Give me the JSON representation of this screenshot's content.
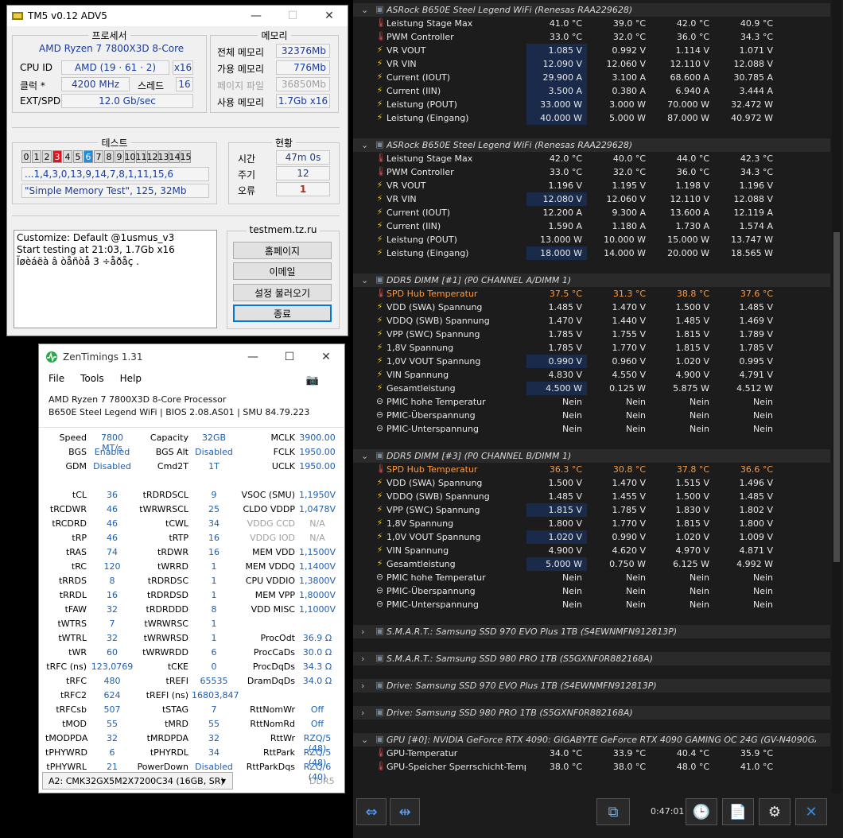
{
  "tm5": {
    "title": "TM5 v0.12 ADV5",
    "processor_group": "프로세서",
    "memory_group": "메모리",
    "cpu_name": "AMD Ryzen 7 7800X3D 8-Core",
    "cpu_id_label": "CPU ID",
    "cpu_id_value": "AMD  (19 · 61 · 2)",
    "cpu_threads_mult": "x16",
    "clock_label": "클럭 *",
    "clock_value": "4200 MHz",
    "thread_label": "스레드",
    "thread_value": "16",
    "extspd_label": "EXT/SPD",
    "extspd_value": "12.0 Gb/sec",
    "mem_total_label": "전체 메모리",
    "mem_total_value": "32376Mb",
    "mem_avail_label": "가용 메모리",
    "mem_avail_value": "776Mb",
    "mem_page_label": "페이지 파일",
    "mem_page_value": "36850Mb",
    "mem_used_label": "사용 메모리",
    "mem_used_value": "1.7Gb x16",
    "test_group": "테스트",
    "status_group": "현황",
    "cells": [
      "0",
      "1",
      "2",
      "3",
      "4",
      "5",
      "6",
      "7",
      "8",
      "9",
      "10",
      "11",
      "12",
      "13",
      "14",
      "15"
    ],
    "sequence": "...1,4,3,0,13,9,14,7,8,1,11,15,6",
    "current_test": "\"Simple Memory Test\", 125, 32Mb",
    "time_label": "시간",
    "time_value": "47m 0s",
    "cycle_label": "주기",
    "cycle_value": "12",
    "error_label": "오류",
    "error_value": "1",
    "log_lines": "Customize: Default @1usmus_v3\nStart testing at 21:03, 1.7Gb x16\nÏøèáëà â òåñòå 3 ÷åðåç .",
    "site": "testmem.tz.ru",
    "btn_home": "홈페이지",
    "btn_email": "이메일",
    "btn_load": "설정 불러오기",
    "btn_exit": "종료",
    "colors": {
      "error": "#e0141e",
      "active": "#1a8ee0"
    }
  },
  "zen": {
    "title": "ZenTimings 1.31",
    "menu": [
      "File",
      "Tools",
      "Help"
    ],
    "cpu": "AMD Ryzen 7 7800X3D 8-Core Processor",
    "board": "B650E Steel Legend WiFi | BIOS 2.08.AS01 | SMU 84.79.223",
    "col1": [
      [
        "Speed",
        "7800 MT/s"
      ],
      [
        "BGS",
        "Enabled"
      ],
      [
        "GDM",
        "Disabled"
      ],
      null,
      [
        "tCL",
        "36"
      ],
      [
        "tRCDWR",
        "46"
      ],
      [
        "tRCDRD",
        "46"
      ],
      [
        "tRP",
        "46"
      ],
      [
        "tRAS",
        "74"
      ],
      [
        "tRC",
        "120"
      ],
      [
        "tRRDS",
        "8"
      ],
      [
        "tRRDL",
        "16"
      ],
      [
        "tFAW",
        "32"
      ],
      [
        "tWTRS",
        "7"
      ],
      [
        "tWTRL",
        "32"
      ],
      [
        "tWR",
        "60"
      ],
      [
        "tRFC (ns)",
        "123,0769"
      ],
      [
        "tRFC",
        "480"
      ],
      [
        "tRFC2",
        "624"
      ],
      [
        "tRFCsb",
        "507"
      ],
      [
        "tMOD",
        "55"
      ],
      [
        "tMODPDA",
        "32"
      ],
      [
        "tPHYWRD",
        "6"
      ],
      [
        "tPHYWRL",
        "21"
      ]
    ],
    "col2": [
      [
        "Capacity",
        "32GB"
      ],
      [
        "BGS Alt",
        "Disabled"
      ],
      [
        "Cmd2T",
        "1T"
      ],
      null,
      [
        "tRDRDSCL",
        "9"
      ],
      [
        "tWRWRSCL",
        "25"
      ],
      [
        "tCWL",
        "34"
      ],
      [
        "tRTP",
        "16"
      ],
      [
        "tRDWR",
        "16"
      ],
      [
        "tWRRD",
        "1"
      ],
      [
        "tRDRDSC",
        "1"
      ],
      [
        "tRDRDSD",
        "1"
      ],
      [
        "tRDRDDD",
        "8"
      ],
      [
        "tWRWRSC",
        "1"
      ],
      [
        "tWRWRSD",
        "1"
      ],
      [
        "tWRWRDD",
        "6"
      ],
      [
        "tCKE",
        "0"
      ],
      [
        "tREFI",
        "65535"
      ],
      [
        "tREFI (ns)",
        "16803,847"
      ],
      [
        "tSTAG",
        "7"
      ],
      [
        "tMRD",
        "55"
      ],
      [
        "tMRDPDA",
        "32"
      ],
      [
        "tPHYRDL",
        "34"
      ],
      [
        "PowerDown",
        "Disabled"
      ]
    ],
    "col3": [
      [
        "MCLK",
        "3900.00"
      ],
      [
        "FCLK",
        "1950.00"
      ],
      [
        "UCLK",
        "1950.00"
      ],
      null,
      [
        "VSOC (SMU)",
        "1,1950V"
      ],
      [
        "CLDO VDDP",
        "1,0478V"
      ],
      [
        "VDDG CCD",
        "N/A"
      ],
      [
        "VDDG IOD",
        "N/A"
      ],
      [
        "MEM VDD",
        "1,1500V"
      ],
      [
        "MEM VDDQ",
        "1,1400V"
      ],
      [
        "CPU VDDIO",
        "1,3800V"
      ],
      [
        "MEM VPP",
        "1,8000V"
      ],
      [
        "VDD MISC",
        "1,1000V"
      ],
      null,
      [
        "ProcOdt",
        "36.9 Ω"
      ],
      [
        "ProcCaDs",
        "30.0 Ω"
      ],
      [
        "ProcDqDs",
        "34.3 Ω"
      ],
      [
        "DramDqDs",
        "34.0 Ω"
      ],
      null,
      [
        "RttNomWr",
        "Off"
      ],
      [
        "RttNomRd",
        "Off"
      ],
      [
        "RttWr",
        "RZQ/5 (48)"
      ],
      [
        "RttPark",
        "RZQ/5 (48)"
      ],
      [
        "RttParkDqs",
        "RZQ/6 (40)"
      ]
    ],
    "module": "A2: CMK32GX5M2X7200C34 (16GB, SR)",
    "ddr": "DDR5"
  },
  "hw": {
    "rows": [
      {
        "t": "h",
        "n": "ASRock B650E Steel Legend WiFi (Renesas RAA229628)"
      },
      {
        "i": "temp",
        "n": "Leistung Stage Max",
        "v": [
          "41.0 °C",
          "39.0 °C",
          "42.0 °C",
          "40.9 °C"
        ]
      },
      {
        "i": "temp",
        "n": "PWM Controller",
        "v": [
          "33.0 °C",
          "32.0 °C",
          "36.0 °C",
          "34.3 °C"
        ]
      },
      {
        "i": "bolt",
        "n": "VR VOUT",
        "v": [
          "1.085 V",
          "0.992 V",
          "1.114 V",
          "1.071 V"
        ],
        "hl": 1
      },
      {
        "i": "bolt",
        "n": "VR VIN",
        "v": [
          "12.090 V",
          "12.060 V",
          "12.110 V",
          "12.088 V"
        ],
        "hl": 1
      },
      {
        "i": "bolt",
        "n": "Current (IOUT)",
        "v": [
          "29.900 A",
          "3.100 A",
          "68.600 A",
          "30.785 A"
        ],
        "hl": 1
      },
      {
        "i": "bolt",
        "n": "Current (IIN)",
        "v": [
          "3.500 A",
          "0.380 A",
          "6.940 A",
          "3.444 A"
        ],
        "hl": 1
      },
      {
        "i": "bolt",
        "n": "Leistung (POUT)",
        "v": [
          "33.000 W",
          "3.000 W",
          "70.000 W",
          "32.472 W"
        ],
        "hl": 1
      },
      {
        "i": "bolt",
        "n": "Leistung (Eingang)",
        "v": [
          "40.000 W",
          "5.000 W",
          "87.000 W",
          "40.972 W"
        ],
        "hl": 1
      },
      {
        "t": "g"
      },
      {
        "t": "h",
        "n": "ASRock B650E Steel Legend WiFi (Renesas RAA229628)"
      },
      {
        "i": "temp",
        "n": "Leistung Stage Max",
        "v": [
          "42.0 °C",
          "40.0 °C",
          "44.0 °C",
          "42.3 °C"
        ]
      },
      {
        "i": "temp",
        "n": "PWM Controller",
        "v": [
          "33.0 °C",
          "32.0 °C",
          "36.0 °C",
          "34.3 °C"
        ]
      },
      {
        "i": "bolt",
        "n": "VR VOUT",
        "v": [
          "1.196 V",
          "1.195 V",
          "1.198 V",
          "1.196 V"
        ]
      },
      {
        "i": "bolt",
        "n": "VR VIN",
        "v": [
          "12.080 V",
          "12.060 V",
          "12.110 V",
          "12.088 V"
        ],
        "hl": 1
      },
      {
        "i": "bolt",
        "n": "Current (IOUT)",
        "v": [
          "12.200 A",
          "9.300 A",
          "13.600 A",
          "12.119 A"
        ]
      },
      {
        "i": "bolt",
        "n": "Current (IIN)",
        "v": [
          "1.590 A",
          "1.180 A",
          "1.730 A",
          "1.574 A"
        ]
      },
      {
        "i": "bolt",
        "n": "Leistung (POUT)",
        "v": [
          "13.000 W",
          "10.000 W",
          "15.000 W",
          "13.747 W"
        ]
      },
      {
        "i": "bolt",
        "n": "Leistung (Eingang)",
        "v": [
          "18.000 W",
          "14.000 W",
          "20.000 W",
          "18.565 W"
        ],
        "hl": 1
      },
      {
        "t": "g"
      },
      {
        "t": "h",
        "n": "DDR5 DIMM [#1] (P0 CHANNEL A/DIMM 1)"
      },
      {
        "i": "temp",
        "n": "SPD Hub Temperatur",
        "v": [
          "37.5 °C",
          "31.3 °C",
          "38.8 °C",
          "37.6 °C"
        ],
        "or": 1
      },
      {
        "i": "bolt",
        "n": "VDD (SWA) Spannung",
        "v": [
          "1.485 V",
          "1.470 V",
          "1.500 V",
          "1.485 V"
        ]
      },
      {
        "i": "bolt",
        "n": "VDDQ (SWB) Spannung",
        "v": [
          "1.470 V",
          "1.440 V",
          "1.485 V",
          "1.469 V"
        ]
      },
      {
        "i": "bolt",
        "n": "VPP (SWC) Spannung",
        "v": [
          "1.785 V",
          "1.755 V",
          "1.815 V",
          "1.789 V"
        ]
      },
      {
        "i": "bolt",
        "n": "1,8V Spannung",
        "v": [
          "1.785 V",
          "1.770 V",
          "1.815 V",
          "1.785 V"
        ]
      },
      {
        "i": "bolt",
        "n": "1,0V VOUT Spannung",
        "v": [
          "0.990 V",
          "0.960 V",
          "1.020 V",
          "0.995 V"
        ],
        "hl": 1
      },
      {
        "i": "bolt",
        "n": "VIN Spannung",
        "v": [
          "4.830 V",
          "4.550 V",
          "4.900 V",
          "4.791 V"
        ]
      },
      {
        "i": "bolt",
        "n": "Gesamtleistung",
        "v": [
          "4.500 W",
          "0.125 W",
          "5.875 W",
          "4.512 W"
        ],
        "hl": 1
      },
      {
        "i": "circ",
        "n": "PMIC hohe Temperatur",
        "v": [
          "Nein",
          "Nein",
          "Nein",
          "Nein"
        ]
      },
      {
        "i": "circ",
        "n": "PMIC-Überspannung",
        "v": [
          "Nein",
          "Nein",
          "Nein",
          "Nein"
        ]
      },
      {
        "i": "circ",
        "n": "PMIC-Unterspannung",
        "v": [
          "Nein",
          "Nein",
          "Nein",
          "Nein"
        ]
      },
      {
        "t": "g"
      },
      {
        "t": "h",
        "n": "DDR5 DIMM [#3] (P0 CHANNEL B/DIMM 1)"
      },
      {
        "i": "temp",
        "n": "SPD Hub Temperatur",
        "v": [
          "36.3 °C",
          "30.8 °C",
          "37.8 °C",
          "36.6 °C"
        ],
        "or": 1
      },
      {
        "i": "bolt",
        "n": "VDD (SWA) Spannung",
        "v": [
          "1.500 V",
          "1.470 V",
          "1.515 V",
          "1.496 V"
        ]
      },
      {
        "i": "bolt",
        "n": "VDDQ (SWB) Spannung",
        "v": [
          "1.485 V",
          "1.455 V",
          "1.500 V",
          "1.485 V"
        ]
      },
      {
        "i": "bolt",
        "n": "VPP (SWC) Spannung",
        "v": [
          "1.815 V",
          "1.785 V",
          "1.830 V",
          "1.802 V"
        ],
        "hl": 1
      },
      {
        "i": "bolt",
        "n": "1,8V Spannung",
        "v": [
          "1.800 V",
          "1.770 V",
          "1.815 V",
          "1.800 V"
        ]
      },
      {
        "i": "bolt",
        "n": "1,0V VOUT Spannung",
        "v": [
          "1.020 V",
          "0.990 V",
          "1.020 V",
          "1.009 V"
        ],
        "hl": 1
      },
      {
        "i": "bolt",
        "n": "VIN Spannung",
        "v": [
          "4.900 V",
          "4.620 V",
          "4.970 V",
          "4.871 V"
        ]
      },
      {
        "i": "bolt",
        "n": "Gesamtleistung",
        "v": [
          "5.000 W",
          "0.750 W",
          "6.125 W",
          "4.992 W"
        ],
        "hl": 1
      },
      {
        "i": "circ",
        "n": "PMIC hohe Temperatur",
        "v": [
          "Nein",
          "Nein",
          "Nein",
          "Nein"
        ]
      },
      {
        "i": "circ",
        "n": "PMIC-Überspannung",
        "v": [
          "Nein",
          "Nein",
          "Nein",
          "Nein"
        ]
      },
      {
        "i": "circ",
        "n": "PMIC-Unterspannung",
        "v": [
          "Nein",
          "Nein",
          "Nein",
          "Nein"
        ]
      },
      {
        "t": "g"
      },
      {
        "t": "c",
        "n": "S.M.A.R.T.: Samsung SSD 970 EVO Plus 1TB (S4EWNMFN912813P)"
      },
      {
        "t": "g"
      },
      {
        "t": "c",
        "n": "S.M.A.R.T.: Samsung SSD 980 PRO 1TB (S5GXNF0R882168A)"
      },
      {
        "t": "g"
      },
      {
        "t": "c",
        "n": "Drive: Samsung SSD 970 EVO Plus 1TB (S4EWNMFN912813P)"
      },
      {
        "t": "g"
      },
      {
        "t": "c",
        "n": "Drive: Samsung SSD 980 PRO 1TB (S5GXNF0R882168A)"
      },
      {
        "t": "g"
      },
      {
        "t": "h",
        "n": "GPU [#0]: NVIDIA GeForce RTX 4090: GIGABYTE GeForce RTX 4090 GAMING OC 24G (GV-N4090GA..."
      },
      {
        "i": "temp",
        "n": "GPU-Temperatur",
        "v": [
          "34.0 °C",
          "33.9 °C",
          "40.4 °C",
          "35.9 °C"
        ]
      },
      {
        "i": "temp",
        "n": "GPU-Speicher Sperrschicht-Temp...",
        "v": [
          "38.0 °C",
          "38.0 °C",
          "48.0 °C",
          "41.0 °C"
        ]
      }
    ],
    "timer": "0:47:01",
    "colors": {
      "highlight": "#ff9a3c",
      "cell_hl": "#1a2a4a"
    }
  }
}
